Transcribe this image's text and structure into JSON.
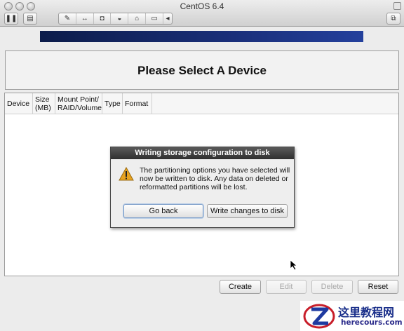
{
  "window": {
    "title": "CentOS 6.4",
    "toolbar_icons": [
      "pause-icon",
      "settings-icon",
      "wrench-icon",
      "network-icon",
      "cd-icon",
      "hdd-icon",
      "usb-icon",
      "shared-folder-icon",
      "chevron-left-icon",
      "window-icon"
    ]
  },
  "installer": {
    "page_title": "Please Select A Device",
    "table_headers": {
      "device": "Device",
      "size": "Size\n(MB)",
      "mount": "Mount Point/\nRAID/Volume",
      "type": "Type",
      "format": "Format"
    },
    "buttons": {
      "create": "Create",
      "edit": "Edit",
      "delete": "Delete",
      "reset": "Reset"
    },
    "progress_color": "#1a2f7a"
  },
  "dialog": {
    "title": "Writing storage configuration to disk",
    "message": "The partitioning options you have selected will now be written to disk.  Any data on deleted or reformatted partitions will be lost.",
    "go_back": "Go back",
    "write": "Write changes to disk",
    "icon": "warning-icon",
    "icon_color": "#e8a320"
  },
  "watermark": {
    "cn": "这里教程网",
    "url": "herecours.com"
  }
}
